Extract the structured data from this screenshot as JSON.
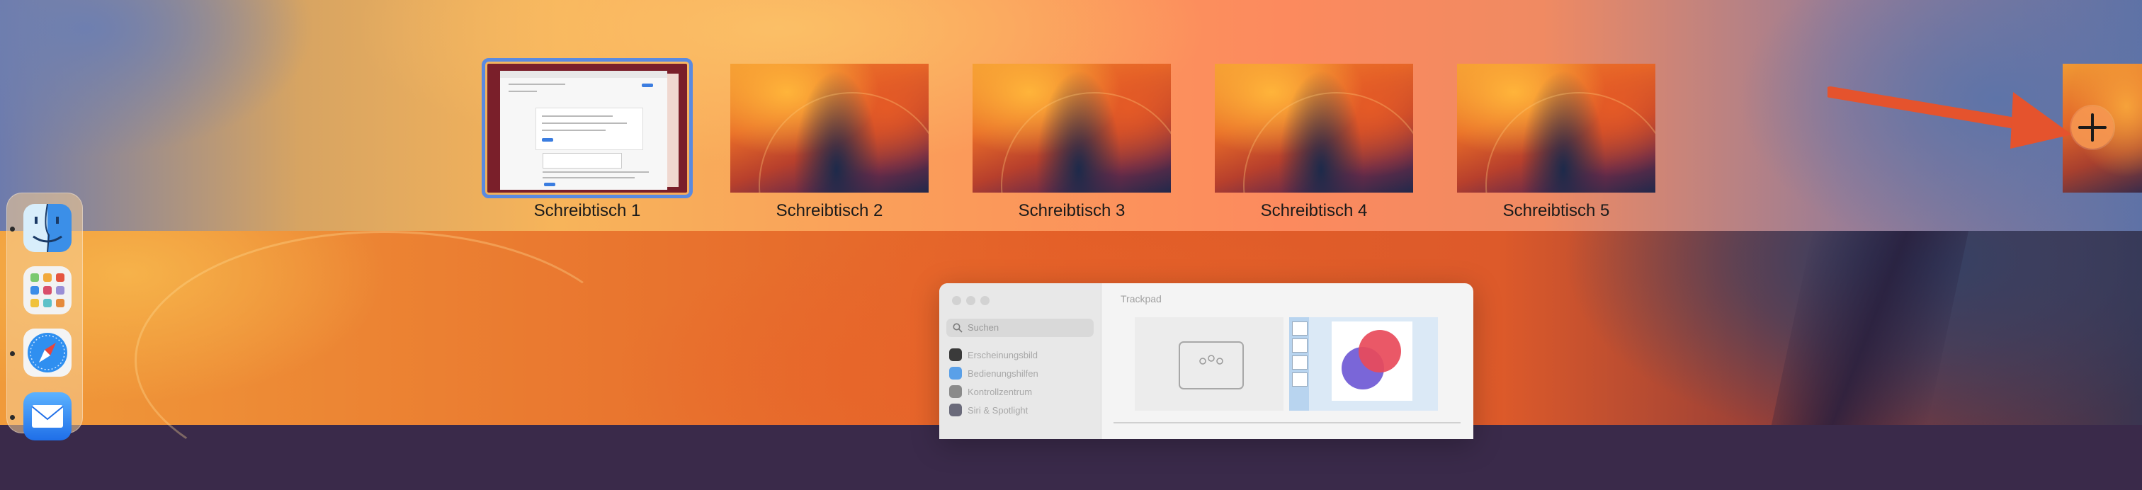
{
  "spaces": [
    {
      "label": "Schreibtisch 1",
      "selected": true
    },
    {
      "label": "Schreibtisch 2",
      "selected": false
    },
    {
      "label": "Schreibtisch 3",
      "selected": false
    },
    {
      "label": "Schreibtisch 4",
      "selected": false
    },
    {
      "label": "Schreibtisch 5",
      "selected": false
    }
  ],
  "add_space": {
    "icon": "plus-icon"
  },
  "annotation": {
    "icon": "red-arrow-icon",
    "color": "#e5532d"
  },
  "dock": {
    "apps": [
      {
        "name": "Finder",
        "icon": "finder-icon",
        "running": true
      },
      {
        "name": "Launchpad",
        "icon": "launchpad-icon",
        "running": false
      },
      {
        "name": "Safari",
        "icon": "safari-icon",
        "running": true
      },
      {
        "name": "Mail",
        "icon": "mail-icon",
        "running": true
      }
    ]
  },
  "settings_window": {
    "search_placeholder": "Suchen",
    "pane_title": "Trackpad",
    "sidebar_items": [
      {
        "label": "Erscheinungsbild",
        "icon": "appearance-icon"
      },
      {
        "label": "Bedienungshilfen",
        "icon": "accessibility-icon"
      },
      {
        "label": "Kontrollzentrum",
        "icon": "control-center-icon"
      },
      {
        "label": "Siri & Spotlight",
        "icon": "siri-icon"
      }
    ]
  },
  "colors": {
    "selection_outline": "#5a8ae0",
    "add_button": "#f5964f"
  }
}
